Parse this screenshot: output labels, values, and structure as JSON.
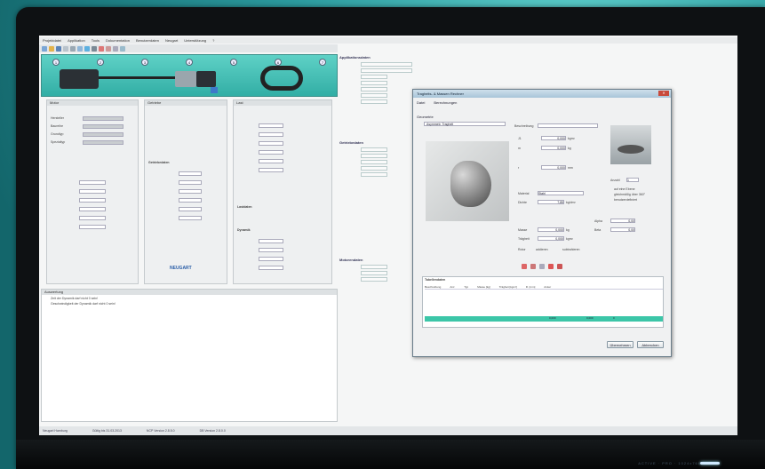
{
  "menu": {
    "items": [
      "Projektdatei",
      "Applikation",
      "Tools",
      "Dokumentation",
      "Benutzerdaten",
      "Neugart",
      "Unterstützung",
      "?"
    ]
  },
  "mechanism": {
    "numbers": [
      "1",
      "2",
      "3",
      "4",
      "5",
      "6",
      "7"
    ]
  },
  "panel_motor": {
    "title": "Motor",
    "items": [
      "Hersteller",
      "Baureihe",
      "Grundtyp",
      "Spezialtyp"
    ],
    "vals": [
      "Motor",
      "Anpassung",
      "Spez",
      "Typ"
    ]
  },
  "panel_gear": {
    "title": "Getriebe",
    "sub": "Getriebedaten",
    "brand": "NEUGART"
  },
  "panel_load": {
    "title": "Last",
    "sub1": "Lastdaten",
    "sub2": "Dynamik"
  },
  "right": {
    "h1": "Applikationsdaten",
    "h2": "Getriebedaten",
    "h3": "Motorendaten"
  },
  "messages": {
    "header": "Auswertung",
    "lines": [
      "Zeit der Dynamik darf nicht 0 sein!",
      "Geschwindigkeit der Dynamik darf nicht 0 sein!"
    ]
  },
  "dialog": {
    "title": "Tragheits- & Massen Rechner",
    "menu": [
      "Datei",
      "Berechnungen"
    ],
    "select_label": "Geometrie",
    "select_value": "Asymmetr. Tragheit",
    "desc_label": "Beschreibung",
    "fields": [
      {
        "l": "J1",
        "v": "0,000",
        "u": "kgm²"
      },
      {
        "l": "m",
        "v": "0,000",
        "u": "kg"
      },
      {
        "l": "r",
        "v": "0,000",
        "u": "mm"
      }
    ],
    "material_label": "Material",
    "material_value": "Stahl",
    "density_label": "Dichte",
    "density_value": "7,85",
    "density_unit": "kg/dm³",
    "mass_label": "Masse",
    "mass_value": "0,000",
    "mass_unit": "kg",
    "inertia_label": "Trägheit",
    "inertia_value": "0,000",
    "inertia_unit": "kgm²",
    "mode": [
      "Rotor",
      "addieren",
      "subtrahieren"
    ],
    "count_label": "Anzahl",
    "count_value": "1",
    "alpha_label": "Alpha",
    "alpha_value": "0,00",
    "beta_label": "Beta",
    "beta_value": "0,00",
    "opts": [
      "auf eine Ebene",
      "gleichmäßig über 360°",
      "benutzerdefiniert"
    ],
    "table_title": "Tabellendaten",
    "cols": [
      "Beschreibung",
      "Anz.",
      "Typ",
      "Masse [kg]",
      "Trägheit [kgm²]",
      "R. [mm]",
      "Anker"
    ],
    "total_row": [
      "0,000",
      "0,000",
      "0"
    ],
    "btn_cancel": "Übernehmen",
    "btn_ok": "Abbrechen"
  },
  "status": [
    "Neugart Hamburg",
    "Gültig bis 31.03.2013",
    "NCP Version 2.8.5.0",
    "DB Version 2.8.0.0"
  ],
  "chin_text": "ACTIVE · PRO · 1024x768"
}
